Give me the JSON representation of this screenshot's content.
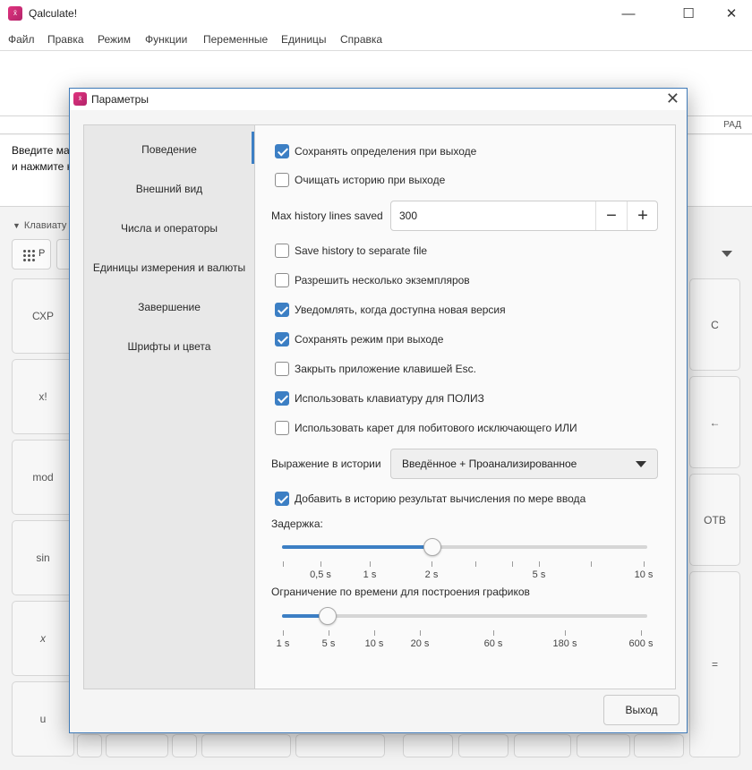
{
  "window": {
    "title": "Qalculate!",
    "minimize": "—",
    "maximize": "☐",
    "close": "✕"
  },
  "menu": [
    "Файл",
    "Правка",
    "Режим",
    "Функции",
    "Переменные",
    "Единицы",
    "Справка"
  ],
  "mode_indicator": "РАД",
  "result_hint": {
    "line1": "Введите мат",
    "line2": "и нажмите к"
  },
  "keyboard_toggle": "Клавиату",
  "top_buttons": {
    "left": "P"
  },
  "keypad": {
    "left_column": [
      "СХР",
      "x!",
      "mod",
      "sin",
      "x",
      "u"
    ],
    "right_column": [
      "C",
      "←",
      "ОТВ",
      "="
    ]
  },
  "dialog": {
    "title": "Параметры",
    "close": "✕",
    "sidebar": [
      "Поведение",
      "Внешний вид",
      "Числа и операторы",
      "Единицы измерения и валюты",
      "Завершение",
      "Шрифты и цвета"
    ],
    "selected_index": 0,
    "options": [
      {
        "label": "Сохранять определения при выходе",
        "checked": true
      },
      {
        "label": "Очищать историю при выходе",
        "checked": false
      },
      {
        "label": "Save history to separate file",
        "checked": false
      },
      {
        "label": "Разрешить несколько экземпляров",
        "checked": false
      },
      {
        "label": "Уведомлять, когда доступна новая версия",
        "checked": true
      },
      {
        "label": "Сохранять режим при выходе",
        "checked": true
      },
      {
        "label": "Закрыть приложение клавишей Esc.",
        "checked": false
      },
      {
        "label": "Использовать клавиатуру для ПОЛИЗ",
        "checked": true
      },
      {
        "label": "Использовать карет для побитового исключающего ИЛИ",
        "checked": false
      },
      {
        "label": "Добавить в историю результат вычисления по мере ввода",
        "checked": true
      }
    ],
    "max_history": {
      "label": "Max history lines saved",
      "value": "300",
      "minus": "−",
      "plus": "+"
    },
    "history_expression": {
      "label": "Выражение в истории",
      "value": "Введённое + Проанализированное"
    },
    "delay_slider": {
      "label": "Задержка:",
      "value_label": "2 s",
      "fraction": 0.411,
      "tick_labels": [
        "",
        "0,5 s",
        "1 s",
        "2 s",
        "",
        "",
        "5 s",
        "",
        "10 s"
      ]
    },
    "plot_slider": {
      "label": "Ограничение по времени для построения графиков",
      "value_label": "5 s",
      "fraction": 0.126,
      "tick_labels": [
        "1 s",
        "5 s",
        "10 s",
        "20 s",
        "60 s",
        "180 s",
        "600 s"
      ]
    },
    "exit_button": "Выход"
  }
}
